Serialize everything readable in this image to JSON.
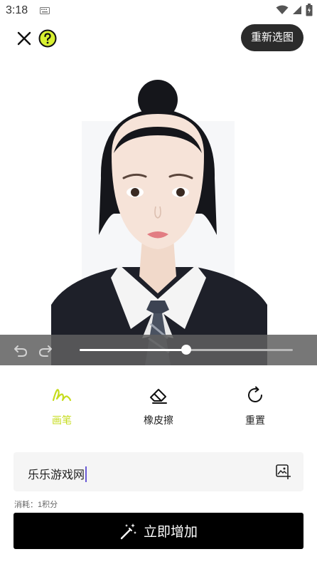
{
  "status_bar": {
    "time": "3:18"
  },
  "top_bar": {
    "reselect_label": "重新选图"
  },
  "editor": {
    "brush_size_fraction": 0.5
  },
  "tools": [
    {
      "label": "画笔",
      "icon": "brush-icon",
      "active": true
    },
    {
      "label": "橡皮擦",
      "icon": "eraser-icon",
      "active": false
    },
    {
      "label": "重置",
      "icon": "reset-icon",
      "active": false
    }
  ],
  "prompt": {
    "value": "乐乐游戏网"
  },
  "cost_text": "消耗：1积分",
  "primary_action": {
    "label": "立即增加",
    "icon": "magic-wand-icon"
  },
  "colors": {
    "accent": "#c6dc1e",
    "button_dark": "#000000",
    "pill": "#2b2b2b"
  }
}
